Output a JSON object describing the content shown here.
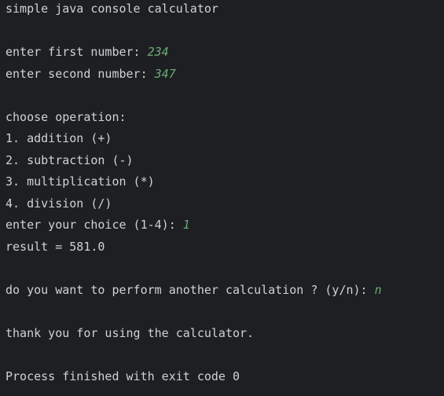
{
  "console": {
    "title_line": "simple java console calculator",
    "first_prompt": "enter first number: ",
    "first_value": "234",
    "second_prompt": "enter second number: ",
    "second_value": "347",
    "choose_heading": "choose operation:",
    "options": [
      "1. addition (+)",
      "2. subtraction (-)",
      "3. multiplication (*)",
      "4. division (/)"
    ],
    "choice_prompt": "enter your choice (1-4): ",
    "choice_value": "1",
    "result_line": "result = 581.0",
    "again_prompt": "do you want to perform another calculation ? (y/n): ",
    "again_value": "n",
    "thanks_line": "thank you for using the calculator.",
    "exit_line": "Process finished with exit code 0"
  },
  "colors": {
    "background": "#1e1f22",
    "text": "#cfd2d6",
    "user_input": "#6aab73"
  }
}
